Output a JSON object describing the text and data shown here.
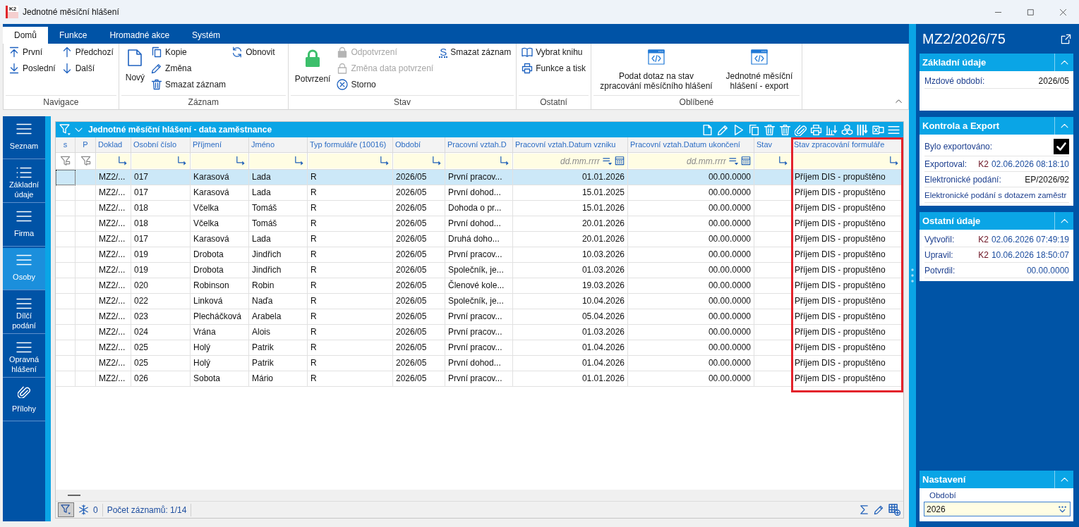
{
  "window": {
    "logo": "K2",
    "title": "Jednotné měsíční hlášení"
  },
  "ribbon": {
    "tabs": [
      {
        "label": "Domů",
        "selected": true
      },
      {
        "label": "Funkce",
        "selected": false
      },
      {
        "label": "Hromadné akce",
        "selected": false
      },
      {
        "label": "Systém",
        "selected": false
      }
    ],
    "groups": [
      {
        "label": "Navigace",
        "stacks": [
          [
            {
              "kind": "small",
              "label": "První",
              "disabled": false
            },
            {
              "kind": "small",
              "label": "Poslední",
              "disabled": false
            }
          ],
          [
            {
              "kind": "small",
              "label": "Předchozí",
              "disabled": false
            },
            {
              "kind": "small",
              "label": "Další",
              "disabled": false
            }
          ]
        ]
      },
      {
        "label": "Záznam",
        "stacks": [
          [
            {
              "kind": "large",
              "label": "Nový",
              "disabled": false
            }
          ],
          [
            {
              "kind": "small",
              "label": "Kopie",
              "disabled": false
            },
            {
              "kind": "small",
              "label": "Změna",
              "disabled": false
            },
            {
              "kind": "small",
              "label": "Smazat záznam",
              "disabled": false
            }
          ],
          [
            {
              "kind": "small",
              "label": "Obnovit",
              "disabled": false
            }
          ]
        ]
      },
      {
        "label": "Stav",
        "stacks": [
          [
            {
              "kind": "large",
              "label": "Potvrzení",
              "disabled": false
            }
          ],
          [
            {
              "kind": "small",
              "label": "Odpotvrzení",
              "disabled": true
            },
            {
              "kind": "small",
              "label": "Změna data potvrzení",
              "disabled": true
            },
            {
              "kind": "small",
              "label": "Storno",
              "disabled": false
            }
          ],
          [
            {
              "kind": "small",
              "label": "Smazat záznam",
              "glyph": "S",
              "disabled": false
            }
          ]
        ]
      },
      {
        "label": "Ostatní",
        "stacks": [
          [
            {
              "kind": "small",
              "label": "Vybrat knihu",
              "disabled": false
            },
            {
              "kind": "small",
              "label": "Funkce a tisk",
              "disabled": false
            }
          ]
        ]
      },
      {
        "label": "Oblíbené",
        "stacks": [
          [
            {
              "kind": "large",
              "label": "Podat dotaz na stav zpracování měsíčního hlášení",
              "disabled": false
            }
          ],
          [
            {
              "kind": "large",
              "label": "Jednotné měsíční hlášení - export",
              "disabled": false
            }
          ]
        ]
      }
    ]
  },
  "navigation": {
    "items": [
      {
        "label": "Seznam",
        "selected": false
      },
      {
        "label": "Základní údaje",
        "selected": false
      },
      {
        "label": "Firma",
        "selected": false
      },
      {
        "label": "Osoby",
        "selected": true
      },
      {
        "label": "Dílčí podání",
        "selected": false
      },
      {
        "label": "Opravná hlášení",
        "selected": false
      },
      {
        "label": "Přílohy",
        "selected": false
      }
    ]
  },
  "grid": {
    "title": "Jednotné měsíční hlášení - data zaměstnance",
    "columns": [
      {
        "label": "s",
        "kind": "flag",
        "highlighted": false
      },
      {
        "label": "P",
        "kind": "flag",
        "highlighted": false
      },
      {
        "label": "Doklad",
        "kind": "text",
        "highlighted": false
      },
      {
        "label": "Osobní číslo",
        "kind": "text",
        "highlighted": false
      },
      {
        "label": "Příjmení",
        "kind": "text",
        "highlighted": false
      },
      {
        "label": "Jméno",
        "kind": "text",
        "highlighted": false
      },
      {
        "label": "Typ formuláře (10016)",
        "kind": "text",
        "highlighted": false
      },
      {
        "label": "Období",
        "kind": "text",
        "highlighted": false
      },
      {
        "label": "Pracovní vztah.D",
        "kind": "text",
        "highlighted": false
      },
      {
        "label": "Pracovní vztah.Datum vzniku",
        "kind": "date",
        "highlighted": false,
        "filter": {
          "placeholder": "dd.mm.rrrr"
        }
      },
      {
        "label": "Pracovní vztah.Datum ukončení",
        "kind": "date",
        "highlighted": false,
        "filter": {
          "placeholder": "dd.mm.rrrr"
        }
      },
      {
        "label": "Stav",
        "kind": "text",
        "highlighted": false
      },
      {
        "label": "Stav zpracování formuláře",
        "kind": "text",
        "highlighted": true
      }
    ],
    "rows": [
      {
        "selected": true,
        "cells": [
          "",
          "",
          "MZ2/...",
          "017",
          "Karasová",
          "Lada",
          "R",
          "2026/05",
          "První pracov...",
          "01.01.2026",
          "00.00.0000",
          "",
          "Příjem DIS - propuštěno"
        ]
      },
      {
        "selected": false,
        "cells": [
          "",
          "",
          "MZ2/...",
          "017",
          "Karasová",
          "Lada",
          "R",
          "2026/05",
          "První dohod...",
          "15.01.2025",
          "00.00.0000",
          "",
          "Příjem DIS - propuštěno"
        ]
      },
      {
        "selected": false,
        "cells": [
          "",
          "",
          "MZ2/...",
          "018",
          "Včelka",
          "Tomáš",
          "R",
          "2026/05",
          "Dohoda o pr...",
          "15.01.2026",
          "00.00.0000",
          "",
          "Příjem DIS - propuštěno"
        ]
      },
      {
        "selected": false,
        "cells": [
          "",
          "",
          "MZ2/...",
          "018",
          "Včelka",
          "Tomáš",
          "R",
          "2026/05",
          "První dohod...",
          "20.01.2026",
          "00.00.0000",
          "",
          "Příjem DIS - propuštěno"
        ]
      },
      {
        "selected": false,
        "cells": [
          "",
          "",
          "MZ2/...",
          "017",
          "Karasová",
          "Lada",
          "R",
          "2026/05",
          "Druhá doho...",
          "20.01.2026",
          "00.00.0000",
          "",
          "Příjem DIS - propuštěno"
        ]
      },
      {
        "selected": false,
        "cells": [
          "",
          "",
          "MZ2/...",
          "019",
          "Drobota",
          "Jindřich",
          "R",
          "2026/05",
          "První pracov...",
          "10.03.2026",
          "00.00.0000",
          "",
          "Příjem DIS - propuštěno"
        ]
      },
      {
        "selected": false,
        "cells": [
          "",
          "",
          "MZ2/...",
          "019",
          "Drobota",
          "Jindřich",
          "R",
          "2026/05",
          "Společník, je...",
          "01.03.2026",
          "00.00.0000",
          "",
          "Příjem DIS - propuštěno"
        ]
      },
      {
        "selected": false,
        "cells": [
          "",
          "",
          "MZ2/...",
          "020",
          "Robinson",
          "Robin",
          "R",
          "2026/05",
          "Členové kole...",
          "19.03.2026",
          "00.00.0000",
          "",
          "Příjem DIS - propuštěno"
        ]
      },
      {
        "selected": false,
        "cells": [
          "",
          "",
          "MZ2/...",
          "022",
          "Linková",
          "Naďa",
          "R",
          "2026/05",
          "Společník, je...",
          "10.04.2026",
          "00.00.0000",
          "",
          "Příjem DIS - propuštěno"
        ]
      },
      {
        "selected": false,
        "cells": [
          "",
          "",
          "MZ2/...",
          "023",
          "Plecháčková",
          "Arabela",
          "R",
          "2026/05",
          "První pracov...",
          "05.04.2026",
          "00.00.0000",
          "",
          "Příjem DIS - propuštěno"
        ]
      },
      {
        "selected": false,
        "cells": [
          "",
          "",
          "MZ2/...",
          "024",
          "Vrána",
          "Alois",
          "R",
          "2026/05",
          "První pracov...",
          "01.03.2026",
          "00.00.0000",
          "",
          "Příjem DIS - propuštěno"
        ]
      },
      {
        "selected": false,
        "cells": [
          "",
          "",
          "MZ2/...",
          "025",
          "Holý",
          "Patrik",
          "R",
          "2026/05",
          "První pracov...",
          "01.04.2026",
          "00.00.0000",
          "",
          "Příjem DIS - propuštěno"
        ]
      },
      {
        "selected": false,
        "cells": [
          "",
          "",
          "MZ2/...",
          "025",
          "Holý",
          "Patrik",
          "R",
          "2026/05",
          "První dohod...",
          "01.04.2026",
          "00.00.0000",
          "",
          "Příjem DIS - propuštěno"
        ]
      },
      {
        "selected": false,
        "cells": [
          "",
          "",
          "MZ2/...",
          "026",
          "Sobota",
          "Mário",
          "R",
          "2026/05",
          "První pracov...",
          "01.01.2026",
          "00.00.0000",
          "",
          "Příjem DIS - propuštěno"
        ]
      }
    ],
    "status_bar": {
      "filter_on": true,
      "count": "0",
      "record_count": "Počet záznamů: 1/14"
    }
  },
  "detail_panel": {
    "title": "MZ2/2026/75",
    "sections": [
      {
        "title": "Základní údaje",
        "expanded": true,
        "fields": [
          {
            "kind": "text",
            "label": "Mzdové období:",
            "value": "2026/05"
          }
        ]
      },
      {
        "title": "Kontrola a Export",
        "expanded": true,
        "fields": [
          {
            "kind": "check",
            "label": "Bylo exportováno:",
            "checked": true
          },
          {
            "kind": "stamp",
            "label": "Exportoval:",
            "user": "K2",
            "time": "02.06.2026 08:18:10"
          },
          {
            "kind": "text",
            "label": "Elektronické podání:",
            "value": "EP/2026/92"
          },
          {
            "kind": "label",
            "label": "Elektronické podání s dotazem zaměstr"
          }
        ]
      },
      {
        "title": "Ostatní údaje",
        "expanded": true,
        "fields": [
          {
            "kind": "stamp",
            "label": "Vytvořil:",
            "user": "K2",
            "time": "02.06.2026 07:49:19"
          },
          {
            "kind": "stamp",
            "label": "Upravil:",
            "user": "K2",
            "time": "10.06.2026 18:50:07"
          },
          {
            "kind": "date",
            "label": "Potvrdil:",
            "value": "00.00.0000"
          }
        ]
      }
    ],
    "settings": {
      "title": "Nastavení",
      "expanded": true,
      "field_label": "Období",
      "value": "2026"
    }
  }
}
